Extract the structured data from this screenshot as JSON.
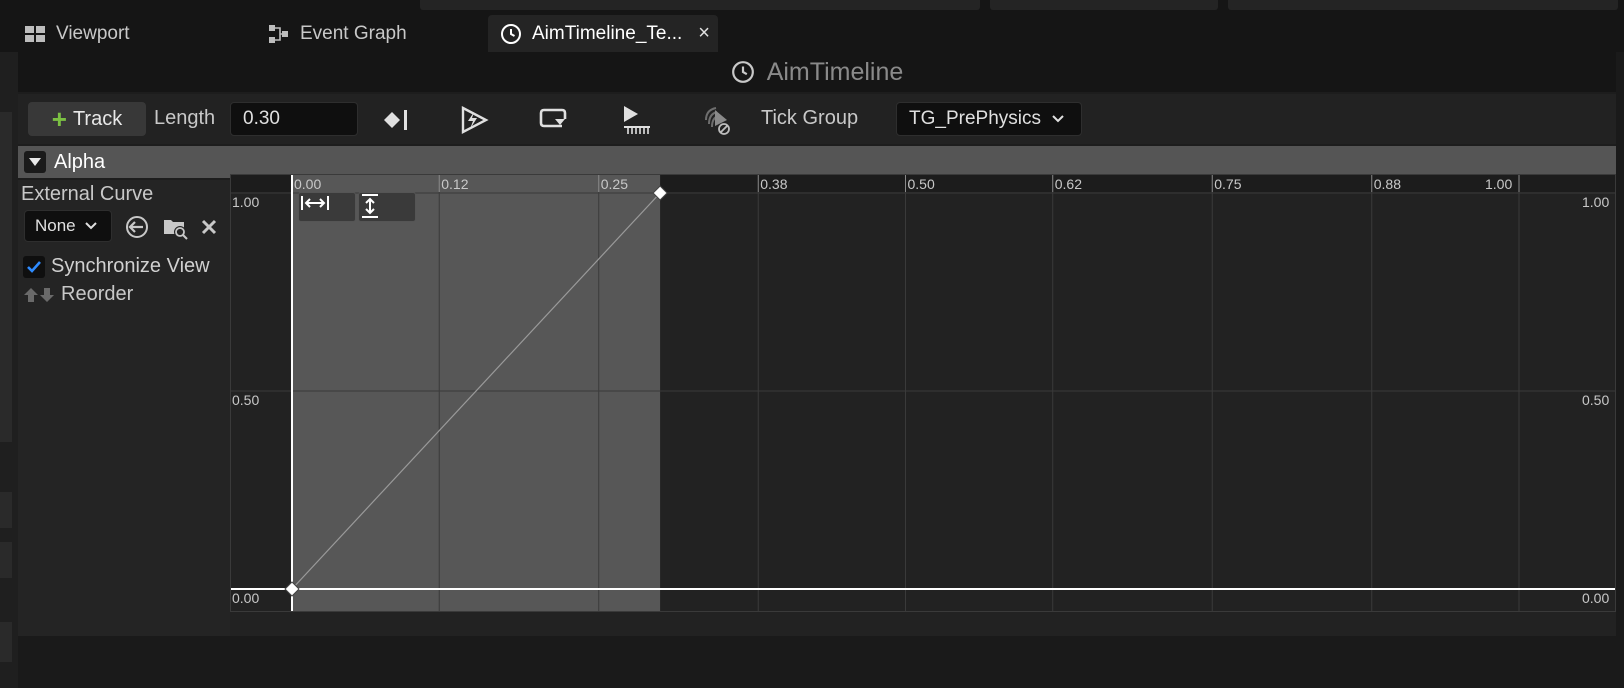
{
  "tabs": [
    {
      "label": "Viewport",
      "icon": "viewport-icon",
      "active": false
    },
    {
      "label": "Event Graph",
      "icon": "event-graph-icon",
      "active": false
    },
    {
      "label": "AimTimeline_Te...",
      "icon": "clock-icon",
      "active": true,
      "close": "×"
    }
  ],
  "panel": {
    "title": "AimTimeline"
  },
  "toolbar": {
    "track_label": "Track",
    "length_label": "Length",
    "length_value": "0.30",
    "tick_group_label": "Tick Group",
    "tick_group_value": "TG_PrePhysics",
    "icons": [
      "use-last-keyframe-icon",
      "autoplay-icon",
      "loop-icon",
      "replicated-icon",
      "ignore-time-dilation-icon"
    ]
  },
  "track": {
    "name": "Alpha",
    "external_curve_label": "External Curve",
    "external_curve_value": "None",
    "synchronize_view_label": "Synchronize View",
    "synchronize_view_checked": true,
    "reorder_label": "Reorder"
  },
  "chart_data": {
    "type": "line",
    "x_ticks": [
      "0.00",
      "0.12",
      "0.25",
      "0.38",
      "0.50",
      "0.62",
      "0.75",
      "0.88",
      "1.00"
    ],
    "y_ticks": [
      "1.00",
      "0.50",
      "0.00"
    ],
    "xlim": [
      0,
      1.0
    ],
    "ylim": [
      0,
      1.0
    ],
    "timeline_length": 0.3,
    "keys": [
      {
        "x": 0.0,
        "y": 0.0
      },
      {
        "x": 0.3,
        "y": 1.0
      }
    ],
    "colors": {
      "active_region": "#575757",
      "background": "#222222",
      "curve": "#9a9a9a",
      "grid": "#3a3a3a"
    }
  }
}
